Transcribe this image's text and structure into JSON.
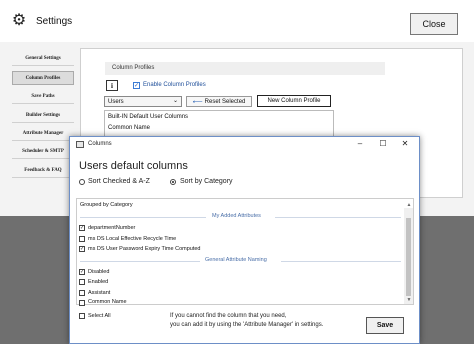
{
  "settings": {
    "title": "Settings",
    "close_label": "Close",
    "nav": [
      "General Settings",
      "Column Profiles",
      "Save Paths",
      "Builder Settings",
      "Attribute Manager",
      "Scheduler & SMTP",
      "Feedback & FAQ"
    ],
    "active_nav": "Column Profiles",
    "column_profiles_label": "Column Profiles",
    "info_label": "i",
    "enable_label": "Enable Column Profiles",
    "users_select": "Users",
    "reset_label": "Reset Selected",
    "new_profile_label": "New Column Profile",
    "profiles": [
      "Built-IN Default User Columns",
      "Common Name"
    ]
  },
  "dialog": {
    "title": "Columns",
    "heading": "Users default columns",
    "sort_checked": "Sort Checked & A-Z",
    "sort_category": "Sort by Category",
    "selected_sort": "Sort by Category",
    "grouped_label": "Grouped by Category",
    "groups": [
      {
        "name": "My Added Attributes",
        "items": [
          {
            "label": "departmentNumber",
            "checked": true
          },
          {
            "label": "ms DS Local Effective Recycle Time",
            "checked": false
          },
          {
            "label": "ms DS User Password Expiry Time Computed",
            "checked": true
          }
        ]
      },
      {
        "name": "General Attribute Naming",
        "items": [
          {
            "label": "Disabled",
            "checked": true
          },
          {
            "label": "Enabled",
            "checked": false
          },
          {
            "label": "Assistant",
            "checked": false
          },
          {
            "label": "Common Name",
            "checked": false
          }
        ]
      }
    ],
    "select_all_label": "Select All",
    "footer_line1": "If you cannot find the column that you need,",
    "footer_line2": "you can add it by using the 'Attribute Manager' in settings.",
    "save_label": "Save"
  }
}
